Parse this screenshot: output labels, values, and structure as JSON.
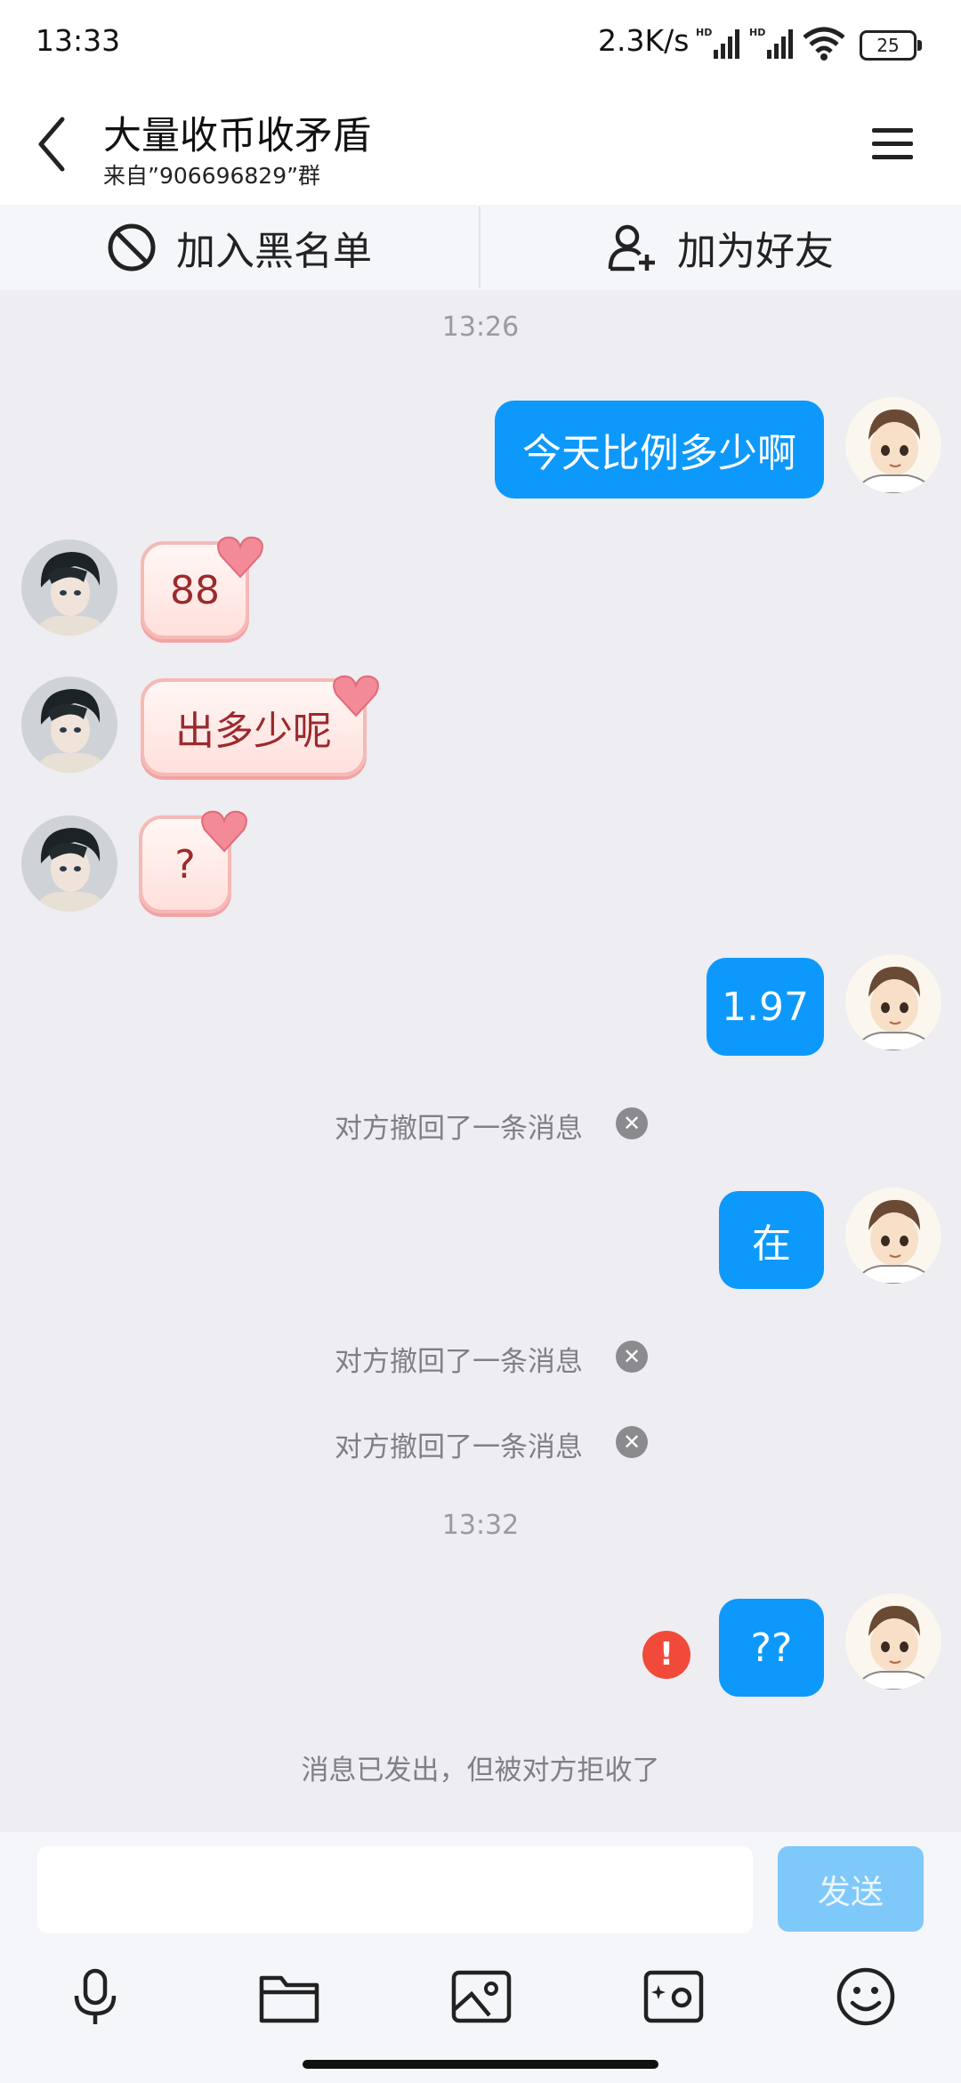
{
  "status": {
    "time": "13:33",
    "speed": "2.3K/s",
    "battery": "25"
  },
  "header": {
    "title": "大量收币收矛盾",
    "subtitle": "来自”906696829”群"
  },
  "actions": {
    "block": "加入黑名单",
    "add_friend": "加为好友"
  },
  "messages": {
    "time1": "13:26",
    "m1": "今天比例多少啊",
    "r1": "88",
    "r2": "出多少呢",
    "r3": "?",
    "m2": "1.97",
    "recall1": "对方撤回了一条消息",
    "m3": "在",
    "recall2": "对方撤回了一条消息",
    "recall3": "对方撤回了一条消息",
    "time2": "13:32",
    "m4": "??",
    "error_mark": "!",
    "rejected": "消息已发出，但被对方拒收了"
  },
  "input": {
    "send": "发送"
  },
  "colors": {
    "accent": "#0d99fc",
    "send_disabled": "#7fc8fa",
    "error": "#f24a3a"
  }
}
